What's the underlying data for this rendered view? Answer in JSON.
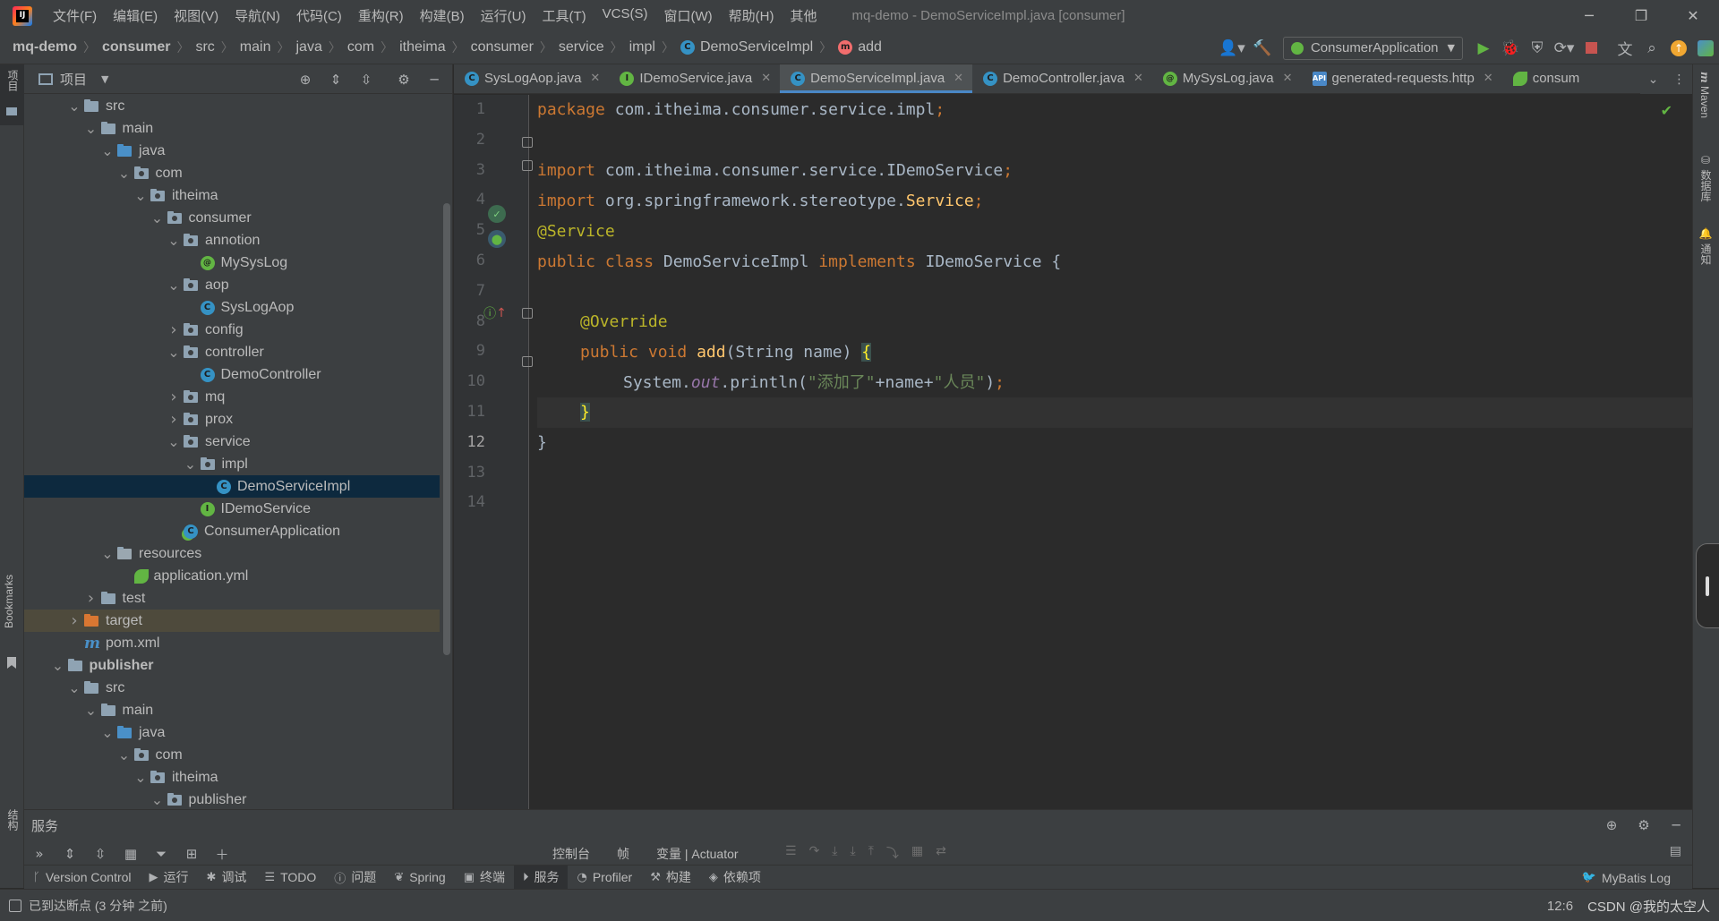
{
  "titlebar": {
    "menu": [
      "文件(F)",
      "编辑(E)",
      "视图(V)",
      "导航(N)",
      "代码(C)",
      "重构(R)",
      "构建(B)",
      "运行(U)",
      "工具(T)",
      "VCS(S)",
      "窗口(W)",
      "帮助(H)",
      "其他"
    ],
    "window_title": "mq-demo - DemoServiceImpl.java [consumer]"
  },
  "breadcrumbs": [
    "mq-demo",
    "consumer",
    "src",
    "main",
    "java",
    "com",
    "itheima",
    "consumer",
    "service",
    "impl",
    "DemoServiceImpl",
    "add"
  ],
  "run_config": "ConsumerApplication",
  "project_panel": {
    "title": "项目",
    "tree": [
      {
        "label": "src",
        "depth": 2,
        "arrow": "down",
        "icon": "folder"
      },
      {
        "label": "main",
        "depth": 3,
        "arrow": "down",
        "icon": "folder"
      },
      {
        "label": "java",
        "depth": 4,
        "arrow": "down",
        "icon": "folder-src"
      },
      {
        "label": "com",
        "depth": 5,
        "arrow": "down",
        "icon": "folder-pkg"
      },
      {
        "label": "itheima",
        "depth": 6,
        "arrow": "down",
        "icon": "folder-pkg"
      },
      {
        "label": "consumer",
        "depth": 7,
        "arrow": "down",
        "icon": "folder-pkg"
      },
      {
        "label": "annotion",
        "depth": 8,
        "arrow": "down",
        "icon": "folder-pkg"
      },
      {
        "label": "MySysLog",
        "depth": 9,
        "arrow": "none",
        "icon": "annotation"
      },
      {
        "label": "aop",
        "depth": 8,
        "arrow": "down",
        "icon": "folder-pkg"
      },
      {
        "label": "SysLogAop",
        "depth": 9,
        "arrow": "none",
        "icon": "class"
      },
      {
        "label": "config",
        "depth": 8,
        "arrow": "right",
        "icon": "folder-pkg"
      },
      {
        "label": "controller",
        "depth": 8,
        "arrow": "down",
        "icon": "folder-pkg"
      },
      {
        "label": "DemoController",
        "depth": 9,
        "arrow": "none",
        "icon": "class"
      },
      {
        "label": "mq",
        "depth": 8,
        "arrow": "right",
        "icon": "folder-pkg"
      },
      {
        "label": "prox",
        "depth": 8,
        "arrow": "right",
        "icon": "folder-pkg"
      },
      {
        "label": "service",
        "depth": 8,
        "arrow": "down",
        "icon": "folder-pkg"
      },
      {
        "label": "impl",
        "depth": 9,
        "arrow": "down",
        "icon": "folder-pkg"
      },
      {
        "label": "DemoServiceImpl",
        "depth": 10,
        "arrow": "none",
        "icon": "class",
        "selected": true
      },
      {
        "label": "IDemoService",
        "depth": 9,
        "arrow": "none",
        "icon": "interface"
      },
      {
        "label": "ConsumerApplication",
        "depth": 8,
        "arrow": "none",
        "icon": "class-run"
      },
      {
        "label": "resources",
        "depth": 4,
        "arrow": "down",
        "icon": "folder-res"
      },
      {
        "label": "application.yml",
        "depth": 5,
        "arrow": "none",
        "icon": "yml"
      },
      {
        "label": "test",
        "depth": 3,
        "arrow": "right",
        "icon": "folder"
      },
      {
        "label": "target",
        "depth": 2,
        "arrow": "right",
        "icon": "folder-excluded",
        "highlight": true
      },
      {
        "label": "pom.xml",
        "depth": 2,
        "arrow": "none",
        "icon": "maven"
      },
      {
        "label": "publisher",
        "depth": 1,
        "arrow": "down",
        "icon": "folder-module",
        "bold": true
      },
      {
        "label": "src",
        "depth": 2,
        "arrow": "down",
        "icon": "folder"
      },
      {
        "label": "main",
        "depth": 3,
        "arrow": "down",
        "icon": "folder"
      },
      {
        "label": "java",
        "depth": 4,
        "arrow": "down",
        "icon": "folder-src"
      },
      {
        "label": "com",
        "depth": 5,
        "arrow": "down",
        "icon": "folder-pkg"
      },
      {
        "label": "itheima",
        "depth": 6,
        "arrow": "down",
        "icon": "folder-pkg"
      },
      {
        "label": "publisher",
        "depth": 7,
        "arrow": "down",
        "icon": "folder-pkg"
      }
    ]
  },
  "editor_tabs": [
    {
      "label": "SysLogAop.java",
      "icon": "class"
    },
    {
      "label": "IDemoService.java",
      "icon": "interface"
    },
    {
      "label": "DemoServiceImpl.java",
      "icon": "class",
      "active": true
    },
    {
      "label": "DemoController.java",
      "icon": "class"
    },
    {
      "label": "MySysLog.java",
      "icon": "annotation"
    },
    {
      "label": "generated-requests.http",
      "icon": "http"
    },
    {
      "label": "consum",
      "icon": "yml",
      "truncated": true
    }
  ],
  "editor": {
    "line_numbers": [
      "1",
      "2",
      "3",
      "4",
      "5",
      "6",
      "7",
      "8",
      "9",
      "10",
      "11",
      "12",
      "13",
      "14"
    ],
    "current_line": 12,
    "code": {
      "l1_kw": "package",
      "l1_rest": " com.itheima.consumer.service.impl",
      "l1_semi": ";",
      "l3_kw": "import",
      "l3_rest": " com.itheima.consumer.service.IDemoService",
      "l3_semi": ";",
      "l4_kw": "import",
      "l4_rest": " org.springframework.stereotype.",
      "l4_cls": "Service",
      "l4_semi": ";",
      "l6_ann": "@Service",
      "l7_kw1": "public class",
      "l7_name": " DemoServiceImpl ",
      "l7_kw2": "implements",
      "l7_rest": " IDemoService {",
      "l9_ann": "@Override",
      "l10_kw": "public void",
      "l10_fn": "add",
      "l10_rest": "(String name) ",
      "l10_brace": "{",
      "l11_a": "System.",
      "l11_out": "out",
      "l11_b": ".println(",
      "l11_s1": "\"添加了\"",
      "l11_c": "+name+",
      "l11_s2": "\"人员\"",
      "l11_d": ")",
      "l11_semi": ";",
      "l12_brace": "}",
      "l13": "}"
    }
  },
  "left_stripe": {
    "project": "项目",
    "bookmarks": "Bookmarks",
    "structure": "结构"
  },
  "right_stripe": {
    "maven": "Maven",
    "database": "数据库",
    "notifications": "通知"
  },
  "services": {
    "title": "服务",
    "tabs": [
      "控制台",
      "帧",
      "变量 | Actuator"
    ]
  },
  "bottom_tools": [
    {
      "label": "Version Control",
      "icon": "branch-icon"
    },
    {
      "label": "运行",
      "icon": "play-icon"
    },
    {
      "label": "调试",
      "icon": "bug-icon"
    },
    {
      "label": "TODO",
      "icon": "list-icon"
    },
    {
      "label": "问题",
      "icon": "info-icon"
    },
    {
      "label": "Spring",
      "icon": "spring-icon"
    },
    {
      "label": "终端",
      "icon": "terminal-icon"
    },
    {
      "label": "服务",
      "icon": "services-icon",
      "active": true
    },
    {
      "label": "Profiler",
      "icon": "profiler-icon"
    },
    {
      "label": "构建",
      "icon": "hammer-icon"
    },
    {
      "label": "依赖项",
      "icon": "layers-icon"
    }
  ],
  "bottom_right_tool": "MyBatis Log",
  "statusbar": {
    "message": "已到达断点 (3 分钟 之前)",
    "position": "12:6",
    "watermark": "CSDN @我的太空人"
  },
  "colors": {
    "accent_blue": "#4a88c7",
    "keyword": "#cc7832",
    "annotation": "#bbb529",
    "string": "#6a8759",
    "function": "#ffc66d",
    "field": "#9876aa",
    "run_green": "#62b543",
    "stop_red": "#c75450"
  }
}
